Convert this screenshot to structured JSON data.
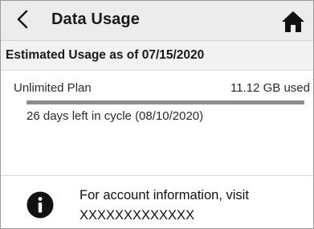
{
  "header": {
    "back_icon": "chevron-left-icon",
    "title": "Data Usage",
    "home_icon": "home-icon"
  },
  "summary": {
    "estimated_label": "Estimated Usage as of 07/15/2020"
  },
  "plan": {
    "name": "Unlimited Plan",
    "used": "11.12 GB used",
    "usage_fraction": 1.0,
    "days_left": "26 days left in cycle (08/10/2020)"
  },
  "info": {
    "icon": "info-icon",
    "line1": "For account information, visit",
    "line2": "XXXXXXXXXXXXX"
  },
  "colors": {
    "header_bg": "#ececec",
    "bar_track": "#d6d6d6",
    "bar_fill": "#8c8c8c"
  }
}
